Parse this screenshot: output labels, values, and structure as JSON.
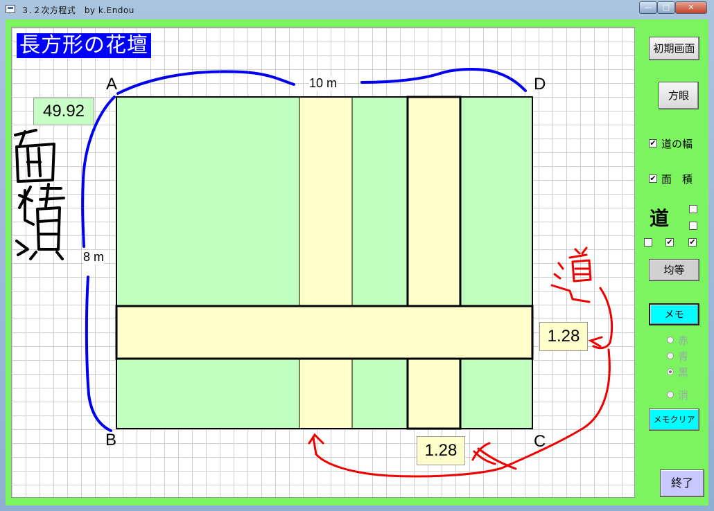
{
  "window": {
    "title": "３.２次方程式　by k.Endou",
    "min": "—",
    "max": "□",
    "close": "✕"
  },
  "canvas": {
    "heading": "長方形の花壇",
    "corners": {
      "a": "A",
      "b": "B",
      "c": "C",
      "d": "D"
    },
    "width_label": "10 m",
    "height_label": "8 m",
    "area_value": "49.92",
    "road_width_right": "1.28",
    "road_width_bottom": "1.28"
  },
  "sidebar": {
    "init_button": "初期画面",
    "grid_button": "方眼",
    "road_width_checkbox": {
      "label": "道の幅",
      "checked": true
    },
    "area_checkbox": {
      "label": "面　積",
      "checked": true
    },
    "road_label": "道",
    "road_checks": [
      false,
      false,
      false,
      true,
      true
    ],
    "even_button": "均等",
    "memo_button": "メモ",
    "colors": [
      {
        "label": "赤",
        "selected": false
      },
      {
        "label": "青",
        "selected": false
      },
      {
        "label": "黒",
        "selected": true
      },
      {
        "label": "消",
        "selected": false
      }
    ],
    "memo_clear_button": "メモクリア",
    "quit_button": "終了"
  },
  "colors": {
    "bed_green": "#c0ffc0",
    "road_yellow": "#ffffcc",
    "client_green": "#7bf45f",
    "heading_blue": "#0000ff",
    "memo_cyan": "#00ffff",
    "ink_blue": "#0000ee",
    "ink_red": "#ee0000"
  }
}
